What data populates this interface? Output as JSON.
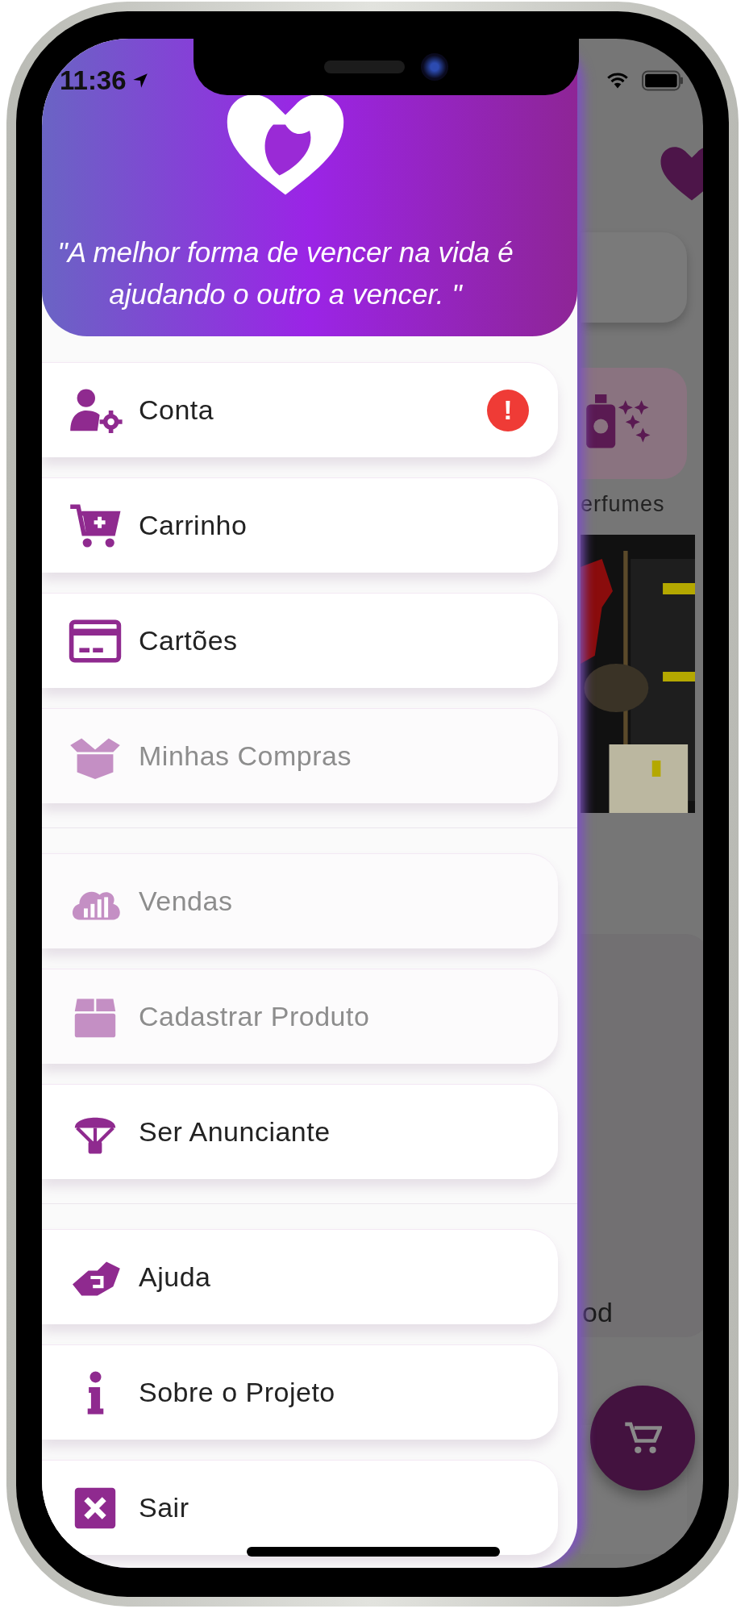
{
  "status_bar": {
    "time": "11:36"
  },
  "drawer": {
    "quote": "\"A melhor forma de vencer na vida é ajudando o outro a vencer. \"",
    "sections": [
      {
        "items": [
          {
            "label": "Conta",
            "disabled": false,
            "badge": "!"
          },
          {
            "label": "Carrinho",
            "disabled": false
          },
          {
            "label": "Cartões",
            "disabled": false
          },
          {
            "label": "Minhas Compras",
            "disabled": true
          }
        ]
      },
      {
        "items": [
          {
            "label": "Vendas",
            "disabled": true
          },
          {
            "label": "Cadastrar Produto",
            "disabled": true
          },
          {
            "label": "Ser Anunciante",
            "disabled": false
          }
        ]
      },
      {
        "items": [
          {
            "label": "Ajuda",
            "disabled": false
          },
          {
            "label": "Sobre o Projeto",
            "disabled": false
          },
          {
            "label": "Sair",
            "disabled": false
          }
        ]
      }
    ]
  },
  "background": {
    "category_label": "erfumes",
    "section_title": "od"
  }
}
